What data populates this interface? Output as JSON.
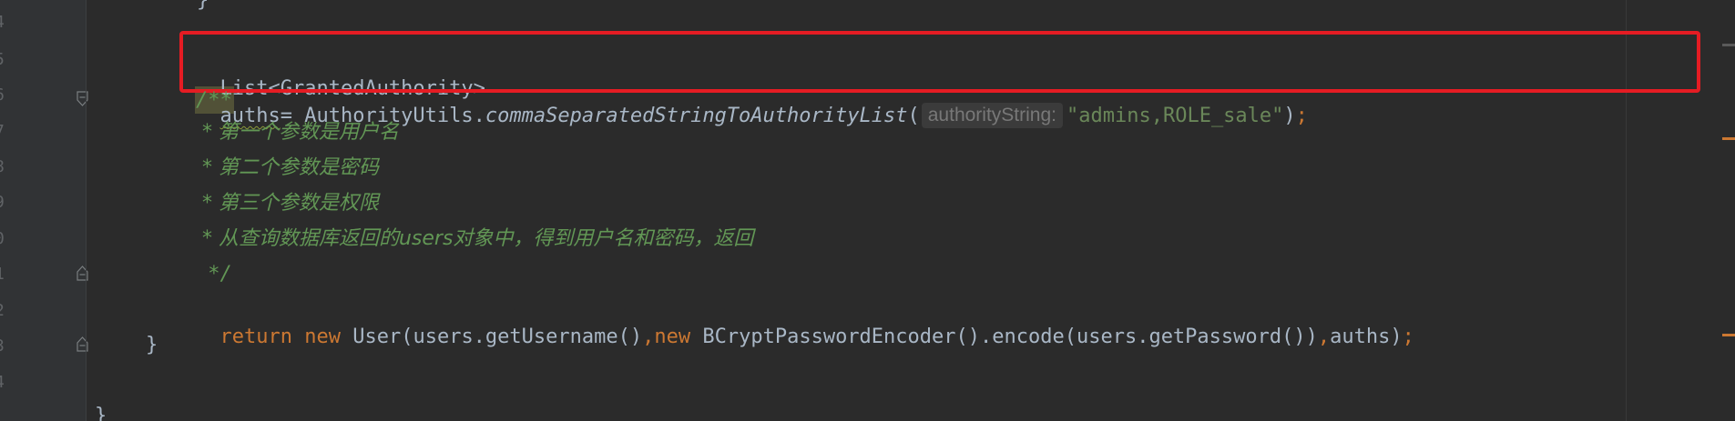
{
  "editor": {
    "line_numbers": [
      "4",
      "5",
      "6",
      "7",
      "8",
      "9",
      "0",
      "1",
      "2",
      "3",
      "4"
    ],
    "lines": {
      "top_brace": "}",
      "l1": {
        "type": "List<GrantedAuthority>",
        "var": "auths",
        "assign": "= AuthorityUtils.",
        "method": "commaSeparatedStringToAuthorityList",
        "open_paren": "(",
        "param_hint": "authorityString:",
        "string_arg": "\"admins,ROLE_sale\"",
        "close_paren": ")",
        "semicolon": ";"
      },
      "doc_start": "/**",
      "c1": " * 第一个参数是用户名",
      "c2": " * 第二个参数是密码",
      "c3": " * 第三个参数是权限",
      "c4": " * 从查询数据库返回的users对象中，得到用户名和密码，返回",
      "doc_end": " */",
      "ret": {
        "kw_return": "return",
        "kw_new1": "new",
        "part1": "User(users.getUsername()",
        "comma1": ",",
        "kw_new2": "new",
        "part2": "BCryptPasswordEncoder().encode(users.getPassword())",
        "comma2": ",",
        "part3": "auths)",
        "semicolon": ";"
      },
      "method_close": "}",
      "class_close": "}"
    }
  },
  "colors": {
    "background": "#2b2b2b",
    "keyword": "#cc7832",
    "string": "#6a8759",
    "comment": "#629755",
    "highlight_box": "#e51c23"
  }
}
